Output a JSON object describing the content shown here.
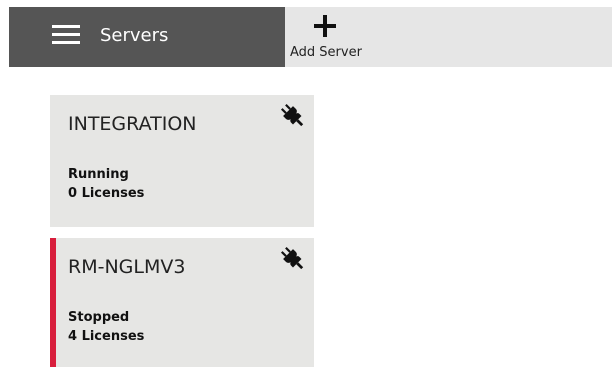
{
  "header": {
    "title": "Servers",
    "menu_icon": "hamburger-menu-icon",
    "add_icon": "plus-icon",
    "add_label": "Add Server"
  },
  "colors": {
    "header_dark": "#555555",
    "header_light": "#e6e6e6",
    "card_bg": "#e6e6e4",
    "stopped_accent": "#d81e3c"
  },
  "servers": [
    {
      "name": "INTEGRATION",
      "status": "Running",
      "licenses": "0 Licenses",
      "icon": "plug-disconnect-icon"
    },
    {
      "name": "RM-NGLMV3",
      "status": "Stopped",
      "licenses": "4 Licenses",
      "icon": "plug-disconnect-icon"
    }
  ]
}
